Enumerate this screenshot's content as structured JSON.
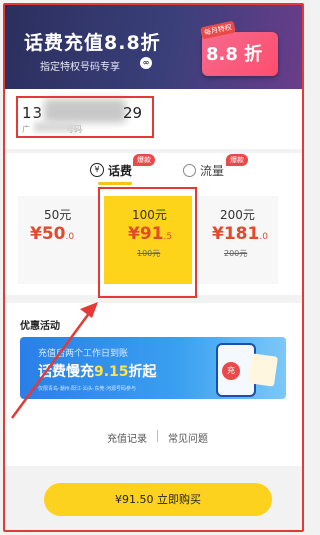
{
  "banner": {
    "title": "话费充值8.8折",
    "subtitle": "指定特权号码专享",
    "subtitle_icon": "∞",
    "tag": "每月特权",
    "badge_text": "8.8 折"
  },
  "phone": {
    "prefix": "13",
    "suffix": "29",
    "carrier_prefix": "广",
    "carrier_suffix": "号码"
  },
  "tabs": [
    {
      "label": "话费",
      "badge": "爆款",
      "icon": "yuan-icon",
      "active": true
    },
    {
      "label": "流量",
      "badge": "爆款",
      "icon": "data-icon",
      "active": false
    }
  ],
  "cards": [
    {
      "face": "50元",
      "price_int": "¥50",
      "price_dec": ".0",
      "original": ""
    },
    {
      "face": "100元",
      "price_int": "¥91",
      "price_dec": ".5",
      "original": "100元"
    },
    {
      "face": "200元",
      "price_int": "¥181",
      "price_dec": ".0",
      "original": "200元"
    }
  ],
  "promo": {
    "section_title": "优惠活动",
    "line1": "充值后两个工作日到账",
    "line2_prefix": "话费慢充",
    "line2_highlight": "9.15",
    "line2_suffix": "折起",
    "line3": "仅限青岛·潮州·阳江·汕头·东莞·河源号码参与",
    "circle": "充"
  },
  "links": {
    "records": "充值记录",
    "faq": "常见问题"
  },
  "buy_button": "¥91.50 立即购买",
  "colors": {
    "accent_yellow": "#fed41a",
    "price_red": "#e34a2b",
    "annotation_red": "#e53935"
  }
}
